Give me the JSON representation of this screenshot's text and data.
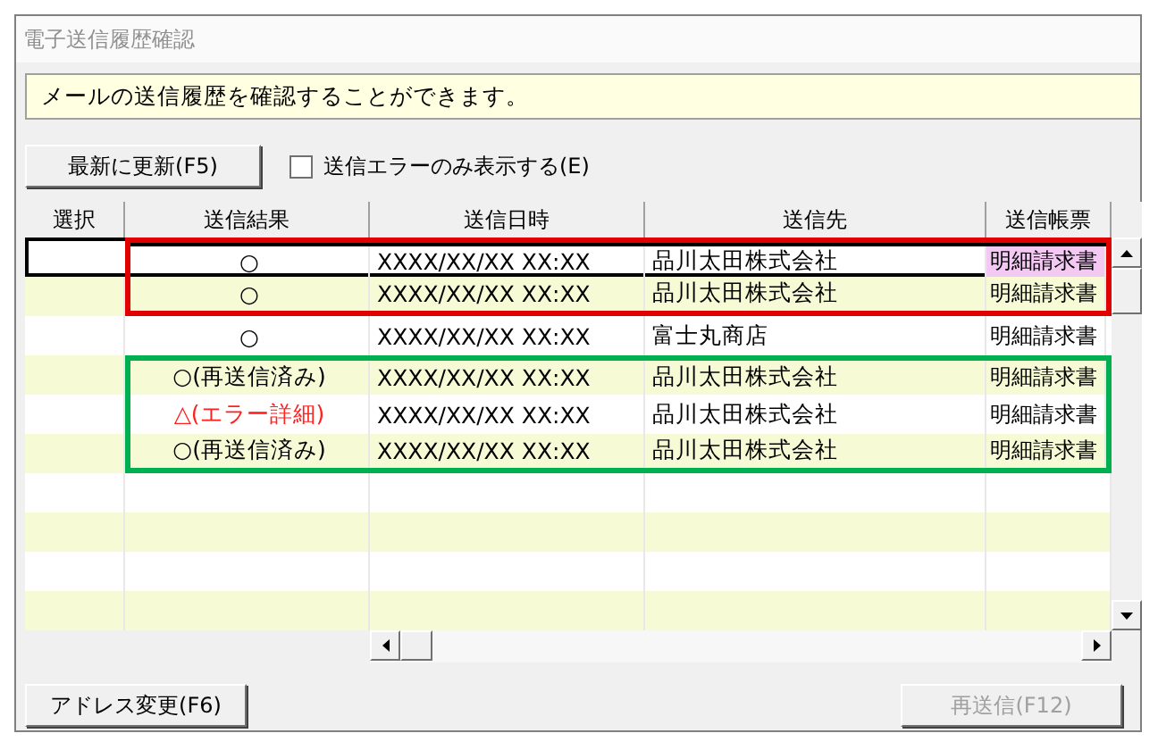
{
  "window": {
    "title": "電子送信履歴確認"
  },
  "info": "メールの送信履歴を確認することができます。",
  "toolbar": {
    "refresh_button": "最新に更新(F5)",
    "error_only": {
      "label": "送信エラーのみ表示する(E)",
      "checked": false
    }
  },
  "table": {
    "columns": [
      "選択",
      "送信結果",
      "送信日時",
      "送信先",
      "送信帳票"
    ],
    "row_groups": [
      {
        "color": "#e00000",
        "rows": [
          {
            "result": "○",
            "kind": "ok",
            "datetime": "XXXX/XX/XX XX:XX",
            "recipient": "品川太田株式会社",
            "document": "明細請求書",
            "selected": true
          },
          {
            "result": "○",
            "kind": "ok",
            "datetime": "XXXX/XX/XX XX:XX",
            "recipient": "品川太田株式会社",
            "document": "明細請求書",
            "selected": false
          }
        ]
      },
      {
        "rows": [
          {
            "result": "○",
            "kind": "ok",
            "datetime": "XXXX/XX/XX XX:XX",
            "recipient": "富士丸商店",
            "document": "明細請求書",
            "selected": false
          }
        ]
      },
      {
        "color": "#00b050",
        "rows": [
          {
            "result": "○(再送信済み)",
            "kind": "ok",
            "datetime": "XXXX/XX/XX XX:XX",
            "recipient": "品川太田株式会社",
            "document": "明細請求書",
            "selected": false
          },
          {
            "result": "△(エラー詳細)",
            "kind": "error",
            "datetime": "XXXX/XX/XX XX:XX",
            "recipient": "品川太田株式会社",
            "document": "明細請求書",
            "selected": false
          },
          {
            "result": "○(再送信済み)",
            "kind": "ok",
            "datetime": "XXXX/XX/XX XX:XX",
            "recipient": "品川太田株式会社",
            "document": "明細請求書",
            "selected": false
          }
        ]
      }
    ]
  },
  "buttons": [
    {
      "label": "アドレス変更(F6)",
      "disabled": false
    },
    {
      "label": "再送信(F12)",
      "disabled": true
    }
  ]
}
